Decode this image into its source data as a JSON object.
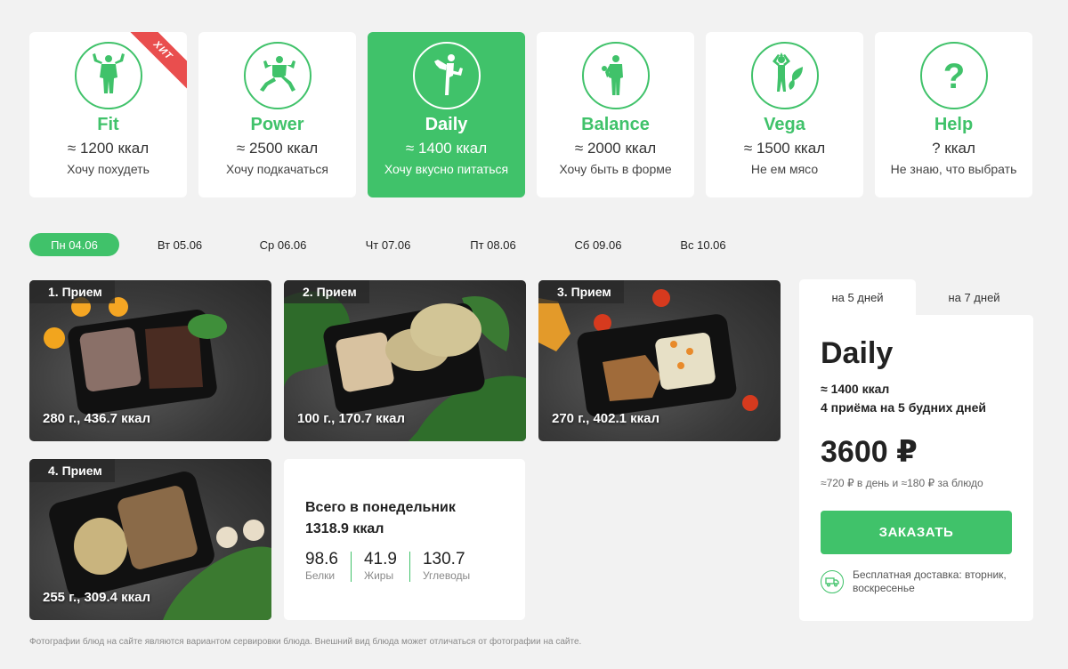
{
  "plans": [
    {
      "name": "Fit",
      "kcal": "≈ 1200 ккал",
      "desc": "Хочу похудеть",
      "badge": "ХИТ",
      "icon": "fit-figure-icon"
    },
    {
      "name": "Power",
      "kcal": "≈ 2500 ккал",
      "desc": "Хочу подкачаться",
      "icon": "power-figure-icon"
    },
    {
      "name": "Daily",
      "kcal": "≈ 1400 ккал",
      "desc": "Хочу вкусно питаться",
      "icon": "daily-figure-icon",
      "active": true
    },
    {
      "name": "Balance",
      "kcal": "≈ 2000 ккал",
      "desc": "Хочу быть в форме",
      "icon": "balance-figure-icon"
    },
    {
      "name": "Vega",
      "kcal": "≈ 1500 ккал",
      "desc": "Не ем мясо",
      "icon": "vega-figure-icon"
    },
    {
      "name": "Help",
      "kcal": "? ккал",
      "desc": "Не знаю, что выбрать",
      "icon": "question-icon"
    }
  ],
  "days": [
    {
      "label": "Пн 04.06",
      "active": true
    },
    {
      "label": "Вт 05.06"
    },
    {
      "label": "Ср 06.06"
    },
    {
      "label": "Чт 07.06"
    },
    {
      "label": "Пт 08.06"
    },
    {
      "label": "Сб 09.06"
    },
    {
      "label": "Вс 10.06"
    }
  ],
  "meals": [
    {
      "tag": "1. Прием",
      "info": "280 г., 436.7 ккал"
    },
    {
      "tag": "2. Прием",
      "info": "100 г., 170.7 ккал"
    },
    {
      "tag": "3. Прием",
      "info": "270 г., 402.1 ккал"
    },
    {
      "tag": "4. Прием",
      "info": "255 г., 309.4 ккал"
    }
  ],
  "totals": {
    "title": "Всего в понедельник",
    "kcal": "1318.9 ккал",
    "macros": [
      {
        "value": "98.6",
        "label": "Белки"
      },
      {
        "value": "41.9",
        "label": "Жиры"
      },
      {
        "value": "130.7",
        "label": "Углеводы"
      }
    ]
  },
  "order": {
    "tabs": [
      {
        "label": "на 5 дней",
        "active": true
      },
      {
        "label": "на 7 дней"
      }
    ],
    "name": "Daily",
    "kcal": "≈ 1400 ккал",
    "meals": "4 приёма на 5 будних дней",
    "price": "3600 ₽",
    "per_day": "≈720 ₽ в день и ≈180 ₽ за блюдо",
    "button": "ЗАКАЗАТЬ",
    "delivery": "Бесплатная доставка: вторник, воскресенье"
  },
  "footnote": "Фотографии блюд на сайте являются вариантом сервировки блюда. Внешний вид блюда может отличаться от фотографии на сайте.",
  "colors": {
    "accent": "#40c26a",
    "badge": "#e94e4e",
    "background": "#f2f2f2"
  }
}
